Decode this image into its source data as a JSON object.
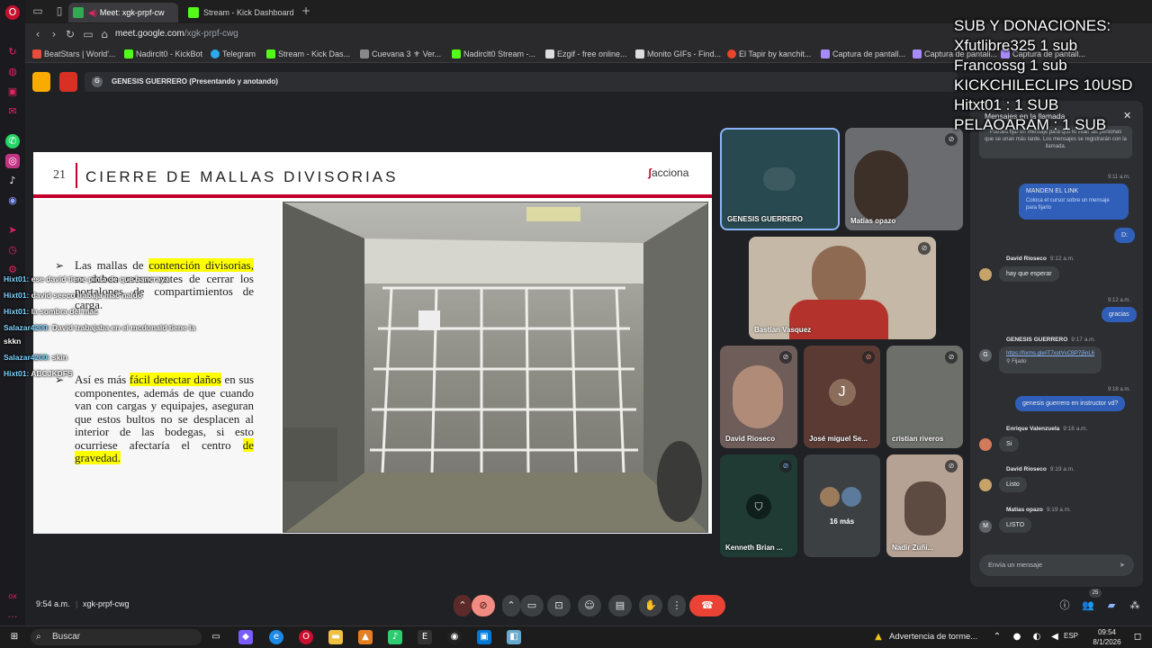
{
  "browser": {
    "tabs": [
      {
        "label": "Meet: xgk-prpf-cw",
        "active": true
      },
      {
        "label": "Stream - Kick Dashboard",
        "active": false
      }
    ],
    "url_host": "meet.google.com",
    "url_path": "/xgk-prpf-cwg",
    "bookmarks": [
      "BeatStars | World'...",
      "Nadirclt0 - KickBot",
      "Telegram",
      "Stream - Kick Das...",
      "Cuevana 3 ⚜ Ver...",
      "Nadirclt0 Stream -...",
      "Ezgif - free online...",
      "Monito GIFs - Find...",
      "El Tapir by kanchit...",
      "Captura de pantall...",
      "Captura de pantall...",
      "Captura de pantall..."
    ]
  },
  "meet": {
    "presenter_label": "GENESIS GUERRERO (Presentando y anotando)",
    "presenter_initial": "G",
    "time": "9:54 a.m.",
    "meeting_code": "xgk-prpf-cwg",
    "people_count": "25"
  },
  "slide": {
    "number": "21",
    "title": "CIERRE DE MALLAS DIVISORIAS",
    "logo": "acciona",
    "bullet1_pre": "Las mallas de ",
    "bullet1_hl": "contención divisorias,",
    "bullet1_post": " se deben cerrar antes de cerrar los portalones de compartimientos de carga.",
    "bullet2_pre": "Así es más ",
    "bullet2_hl1": "fácil detectar daños",
    "bullet2_mid": " en sus componentes, además de que cuando van con cargas y equipajes, aseguran que estos bultos no se desplacen al interior de las bodegas, si esto ocurriese afectaría el centro ",
    "bullet2_hl2": "de gravedad."
  },
  "stream_chat": [
    {
      "user": "Hixt01:",
      "text": "ese david tiene pinta de que bancraya"
    },
    {
      "user": "Hixt01:",
      "text": "david seeco trabaja mac naldo"
    },
    {
      "user": "Hixt01:",
      "text": "la sombra del mac"
    },
    {
      "user": "Salazar4200:",
      "text": "David trabajaba en el mcdonald tiene la"
    },
    {
      "user": "",
      "text": "skkn"
    },
    {
      "user": "Salazar4200:",
      "text": "skin"
    },
    {
      "user": "Hixt01:",
      "text": "ABCJKDFS"
    }
  ],
  "donations": {
    "header": "SUB Y DONACIONES:",
    "lines": [
      "Xfutlibre325 1 sub",
      "Francossg 1 sub",
      "KICKCHILECLIPS 10USD",
      "Hitxt01 : 1 SUB",
      "PELAOARAM : 1 SUB"
    ]
  },
  "participants": [
    {
      "name": "GENESIS GUERRERO"
    },
    {
      "name": "Matias opazo"
    },
    {
      "name": "Bastian Vasquez"
    },
    {
      "name": "David Rioseco"
    },
    {
      "name": "José miguel Se...",
      "initial": "J"
    },
    {
      "name": "cristian riveros"
    },
    {
      "name": "Kenneth Brian ..."
    },
    {
      "name": "16 más"
    },
    {
      "name": "Nadir Zuñi..."
    }
  ],
  "chat_panel": {
    "title": "Mensajes en la llamada",
    "notice": "Puedes fijar un mensaje para que lo vean las personas que se unan más tarde. Los mensajes se registrarán con la llamada.",
    "msg_mine_1_time": "9:11 a.m.",
    "msg_mine_1_title": "MANDEN EL LINK",
    "msg_mine_1_hint": "Coloca el cursor sobre un mensaje para fijarlo",
    "msg_mine_2": "D:",
    "david1_name": "David Rioseco",
    "david1_time": "9:12 a.m.",
    "david1_text": "hay que esperar",
    "mine3_time": "9:12 a.m.",
    "mine3_text": "gracias",
    "genesis_name": "GENESIS GUERRERO",
    "genesis_time": "9:17 a.m.",
    "genesis_link": "https://forms.gle/iT7xotVvCBP7j5nL6",
    "genesis_pinned": "Fijado",
    "mine4_time": "9:18 a.m.",
    "mine4_text": "genesis guerrero en instructor vd?",
    "enrique_name": "Enrique Valenzuela",
    "enrique_time": "9:18 a.m.",
    "enrique_text": "Si",
    "david2_name": "David Rioseco",
    "david2_time": "9:19 a.m.",
    "david2_text": "Listo",
    "matias_name": "Matias opazo",
    "matias_time": "9:19 a.m.",
    "matias_text": "LISTO",
    "matias_initial": "M",
    "input_placeholder": "Envía un mensaje"
  },
  "taskbar": {
    "search_placeholder": "Buscar",
    "weather": "Advertencia de torme...",
    "lang": "ESP",
    "clock_time": "09:54",
    "clock_date": "8/1/2026",
    "rail_label": "ox"
  },
  "colors": {
    "accent_red": "#c0002a",
    "meet_bg": "#202124",
    "highlight": "#ffff00",
    "end_call": "#ea4335"
  }
}
